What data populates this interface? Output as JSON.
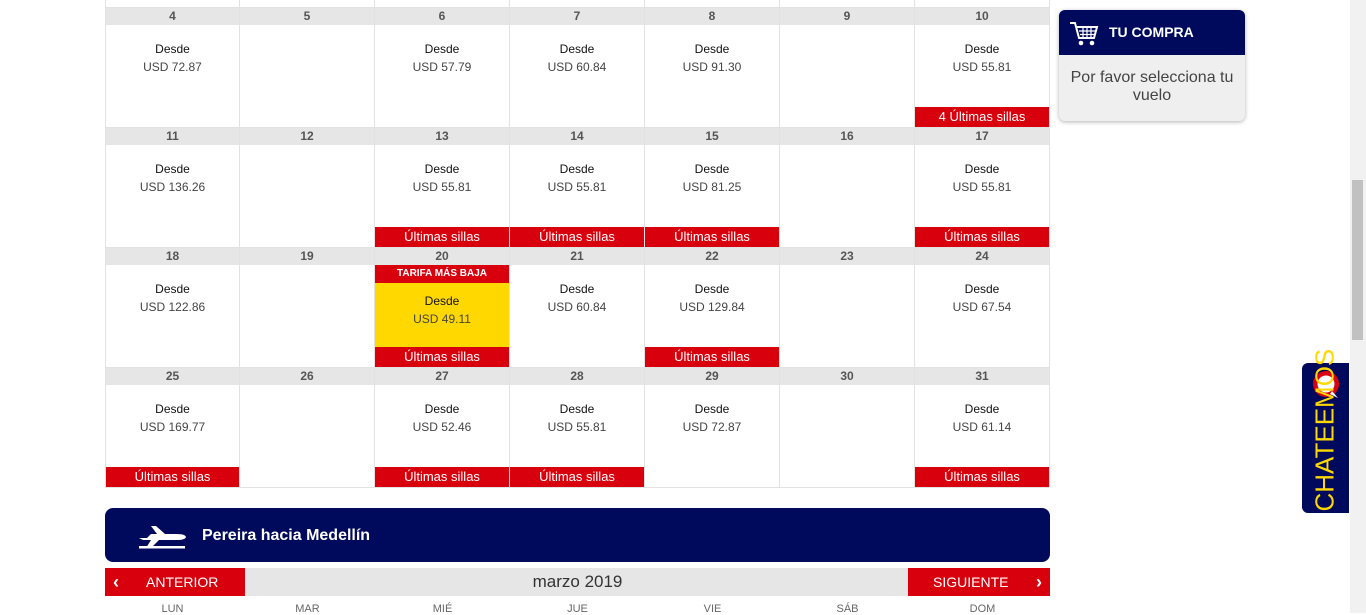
{
  "calendar": {
    "weeks": [
      [
        {
          "day": "4",
          "desde": "Desde",
          "price": "USD 72.87",
          "tag": ""
        },
        {
          "day": "5",
          "desde": "",
          "price": "",
          "tag": ""
        },
        {
          "day": "6",
          "desde": "Desde",
          "price": "USD 57.79",
          "tag": ""
        },
        {
          "day": "7",
          "desde": "Desde",
          "price": "USD 60.84",
          "tag": ""
        },
        {
          "day": "8",
          "desde": "Desde",
          "price": "USD 91.30",
          "tag": ""
        },
        {
          "day": "9",
          "desde": "",
          "price": "",
          "tag": ""
        },
        {
          "day": "10",
          "desde": "Desde",
          "price": "USD 55.81",
          "tag": "4 Últimas sillas"
        }
      ],
      [
        {
          "day": "11",
          "desde": "Desde",
          "price": "USD 136.26",
          "tag": ""
        },
        {
          "day": "12",
          "desde": "",
          "price": "",
          "tag": ""
        },
        {
          "day": "13",
          "desde": "Desde",
          "price": "USD 55.81",
          "tag": "Últimas sillas"
        },
        {
          "day": "14",
          "desde": "Desde",
          "price": "USD 55.81",
          "tag": "Últimas sillas"
        },
        {
          "day": "15",
          "desde": "Desde",
          "price": "USD 81.25",
          "tag": "Últimas sillas"
        },
        {
          "day": "16",
          "desde": "",
          "price": "",
          "tag": ""
        },
        {
          "day": "17",
          "desde": "Desde",
          "price": "USD 55.81",
          "tag": "Últimas sillas"
        }
      ],
      [
        {
          "day": "18",
          "desde": "Desde",
          "price": "USD 122.86",
          "tag": ""
        },
        {
          "day": "19",
          "desde": "",
          "price": "",
          "tag": ""
        },
        {
          "day": "20",
          "desde": "Desde",
          "price": "USD 49.11",
          "tag": "Últimas sillas",
          "lowest": "TARIFA MÁS BAJA"
        },
        {
          "day": "21",
          "desde": "Desde",
          "price": "USD 60.84",
          "tag": ""
        },
        {
          "day": "22",
          "desde": "Desde",
          "price": "USD 129.84",
          "tag": "Últimas sillas"
        },
        {
          "day": "23",
          "desde": "",
          "price": "",
          "tag": ""
        },
        {
          "day": "24",
          "desde": "Desde",
          "price": "USD 67.54",
          "tag": ""
        }
      ],
      [
        {
          "day": "25",
          "desde": "Desde",
          "price": "USD 169.77",
          "tag": "Últimas sillas"
        },
        {
          "day": "26",
          "desde": "",
          "price": "",
          "tag": ""
        },
        {
          "day": "27",
          "desde": "Desde",
          "price": "USD 52.46",
          "tag": "Últimas sillas"
        },
        {
          "day": "28",
          "desde": "Desde",
          "price": "USD 55.81",
          "tag": "Últimas sillas"
        },
        {
          "day": "29",
          "desde": "Desde",
          "price": "USD 72.87",
          "tag": ""
        },
        {
          "day": "30",
          "desde": "",
          "price": "",
          "tag": ""
        },
        {
          "day": "31",
          "desde": "Desde",
          "price": "USD 61.14",
          "tag": "Últimas sillas"
        }
      ]
    ]
  },
  "route": {
    "title": "Pereira hacia Medellín"
  },
  "month_nav": {
    "prev": "ANTERIOR",
    "next": "SIGUIENTE",
    "month": "marzo 2019",
    "prev_arrow": "‹",
    "next_arrow": "›"
  },
  "weekdays": [
    "LUN",
    "MAR",
    "MIÉ",
    "JUE",
    "VIE",
    "SÁB",
    "DOM"
  ],
  "cart": {
    "title": "TU COMPRA",
    "message": "Por favor selecciona tu vuelo"
  },
  "chat": {
    "label": "CHATEEMOS"
  },
  "colors": {
    "navy": "#000a5c",
    "red": "#d9000d",
    "yellow": "#ffd800"
  }
}
